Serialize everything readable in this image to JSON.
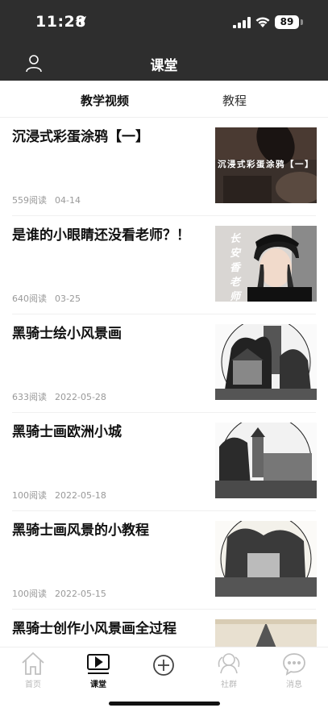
{
  "status_bar": {
    "time": "11:28",
    "battery": "89"
  },
  "header": {
    "title": "课堂"
  },
  "tabs": [
    {
      "label": "教学视频",
      "active": true
    },
    {
      "label": "教程",
      "active": false
    }
  ],
  "videos": [
    {
      "title": "沉浸式彩蛋涂鸦【一】",
      "reads": "559阅读",
      "date": "04-14",
      "thumb_text": "沉浸式彩蛋涂鸦【一】"
    },
    {
      "title": "是谁的小眼睛还没看老师？！",
      "reads": "640阅读",
      "date": "03-25",
      "thumb_text": "长安香老师"
    },
    {
      "title": "黑骑士绘小风景画",
      "reads": "633阅读",
      "date": "2022-05-28"
    },
    {
      "title": "黑骑士画欧洲小城",
      "reads": "100阅读",
      "date": "2022-05-18"
    },
    {
      "title": "黑骑士画风景的小教程",
      "reads": "100阅读",
      "date": "2022-05-15"
    },
    {
      "title": "黑骑士创作小风景画全过程",
      "reads": "",
      "date": ""
    }
  ],
  "tab_bar": [
    {
      "label": "首页",
      "icon": "home-icon",
      "active": false
    },
    {
      "label": "课堂",
      "icon": "video-play-icon",
      "active": true
    },
    {
      "label": "",
      "icon": "add-circle-icon",
      "active": false
    },
    {
      "label": "社群",
      "icon": "community-icon",
      "active": false
    },
    {
      "label": "消息",
      "icon": "message-icon",
      "active": false
    }
  ]
}
